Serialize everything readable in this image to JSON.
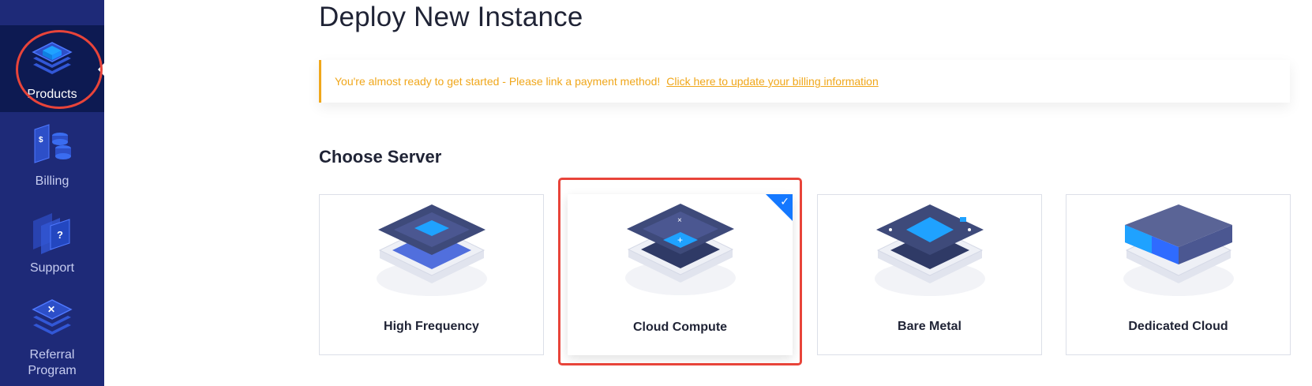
{
  "sidebar": {
    "items": [
      {
        "label": "Products",
        "icon": "layers-icon",
        "active": true
      },
      {
        "label": "Billing",
        "icon": "billing-icon"
      },
      {
        "label": "Support",
        "icon": "support-icon"
      },
      {
        "label": "Referral Program",
        "icon": "referral-icon"
      }
    ]
  },
  "page": {
    "title": "Deploy New Instance"
  },
  "alert": {
    "message": "You're almost ready to get started - Please link a payment method!",
    "link": "Click here to update your billing information",
    "color": "#f0a71b"
  },
  "choose_server": {
    "title": "Choose Server",
    "options": [
      {
        "label": "High Frequency",
        "icon": "high-frequency-server-icon"
      },
      {
        "label": "Cloud Compute",
        "icon": "cloud-compute-server-icon",
        "selected": true
      },
      {
        "label": "Bare Metal",
        "icon": "bare-metal-server-icon"
      },
      {
        "label": "Dedicated Cloud",
        "icon": "dedicated-cloud-server-icon"
      }
    ]
  },
  "colors": {
    "sidebar_bg": "#1e2a78",
    "sidebar_active_bg": "#0d1a52",
    "accent": "#1478ff",
    "highlight": "#e8443a"
  }
}
